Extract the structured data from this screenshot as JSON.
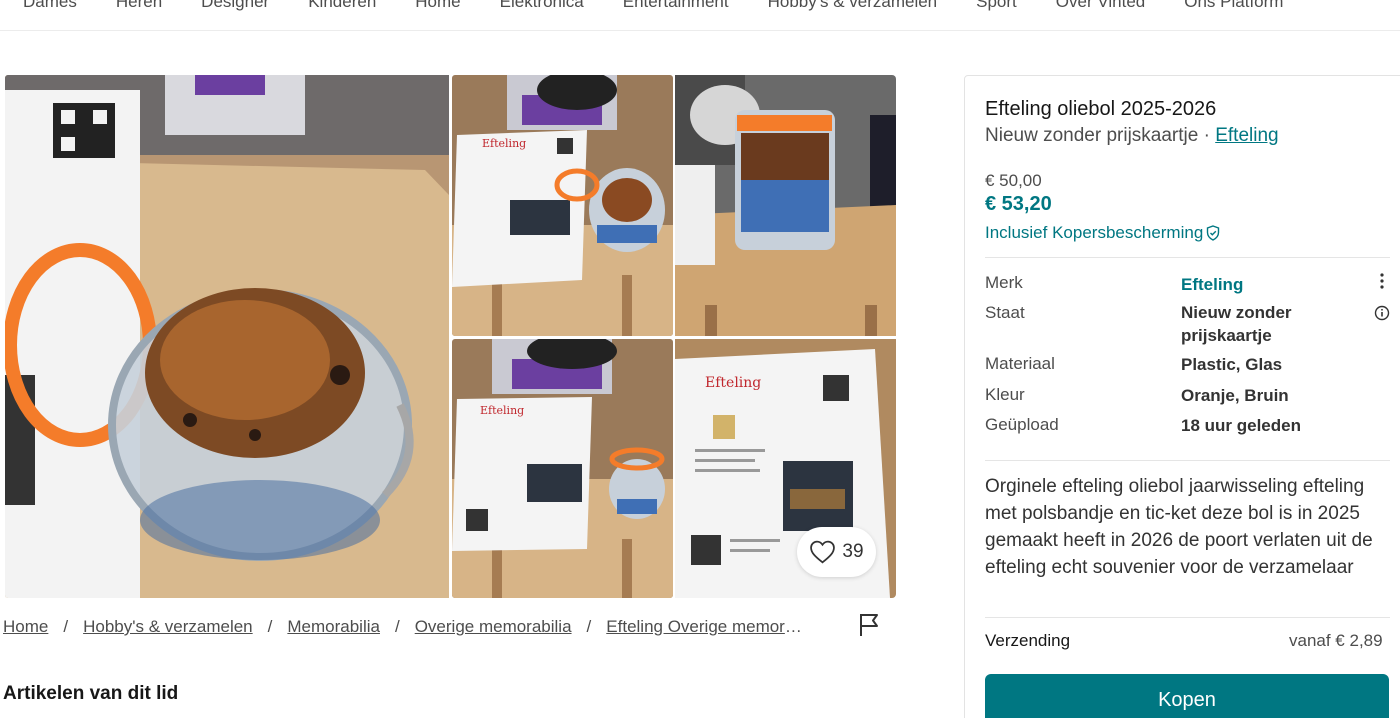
{
  "nav": {
    "items": [
      "Dames",
      "Heren",
      "Designer",
      "Kinderen",
      "Home",
      "Elektronica",
      "Entertainment",
      "Hobby's & verzamelen",
      "Sport",
      "Over Vinted",
      "Ons Platform"
    ]
  },
  "gallery": {
    "favorite_count": "39"
  },
  "breadcrumb": {
    "items": [
      "Home",
      "Hobby's & verzamelen",
      "Memorabilia",
      "Overige memorabilia",
      "Efteling Overige memorabilia"
    ],
    "separator": "/"
  },
  "section": {
    "member_items_title": "Artikelen van dit lid"
  },
  "item": {
    "title": "Efteling oliebol 2025-2026",
    "condition": "Nieuw zonder prijskaartje",
    "dot": "·",
    "brand_link": "Efteling",
    "price_original": "€ 50,00",
    "price_total": "€ 53,20",
    "protection": "Inclusief Kopersbescherming",
    "attributes": [
      {
        "label": "Merk",
        "value": "Efteling"
      },
      {
        "label": "Staat",
        "value": "Nieuw zonder prijskaartje"
      },
      {
        "label": "Materiaal",
        "value": "Plastic, Glas"
      },
      {
        "label": "Kleur",
        "value": "Oranje, Bruin"
      },
      {
        "label": "Geüpload",
        "value": "18 uur geleden"
      }
    ],
    "description": "Orginele efteling oliebol jaarwisseling efteling met polsbandje en tic-ket deze bol is in 2025 gemaakt heeft in 2026 de poort verlaten uit de efteling echt souvenier voor de verzamelaar",
    "shipping_label": "Verzending",
    "shipping_value": "vanaf € 2,89",
    "buy_label": "Kopen"
  },
  "colors": {
    "accent": "#007782",
    "jar_lid": "#f47c2a",
    "table_wood": "#c9a070"
  },
  "icons": {
    "favorite": "heart-icon",
    "report": "flag-icon",
    "more": "more-vertical-icon",
    "info": "info-icon",
    "protection": "shield-check-icon"
  }
}
